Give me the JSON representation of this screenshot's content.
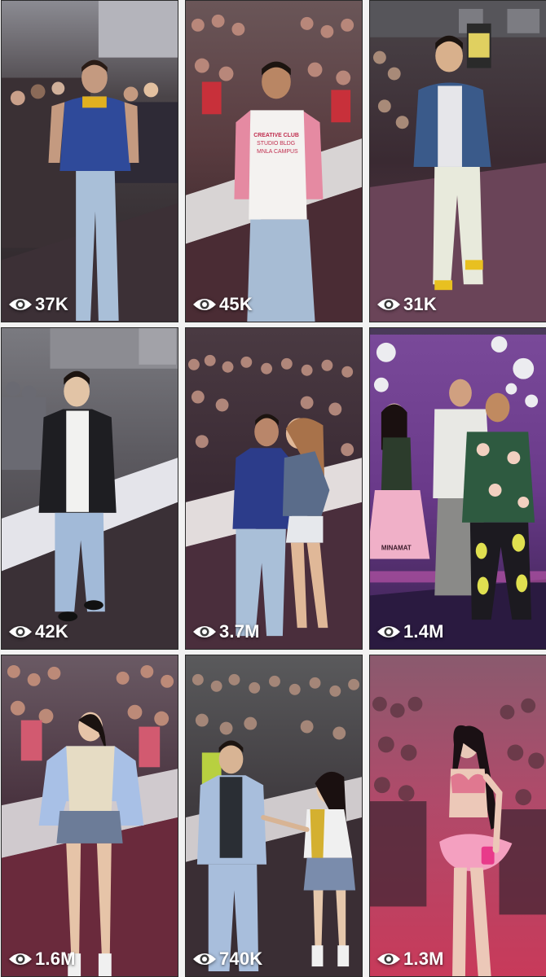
{
  "colors": {
    "text": "#ffffff",
    "border": "#2b2b2b",
    "page_bg": "#f2f2f2"
  },
  "tiles": [
    {
      "views": "37K",
      "icon": "eye-icon"
    },
    {
      "views": "45K",
      "icon": "eye-icon",
      "shirt_print": [
        "CREATIVE CLUB",
        "STUDIO BLDG",
        "MNLA CAMPUS"
      ]
    },
    {
      "views": "31K",
      "icon": "eye-icon"
    },
    {
      "views": "42K",
      "icon": "eye-icon"
    },
    {
      "views": "3.7M",
      "icon": "eye-icon"
    },
    {
      "views": "1.4M",
      "icon": "eye-icon",
      "skirt_print": "MINAMAT"
    },
    {
      "views": "1.6M",
      "icon": "eye-icon"
    },
    {
      "views": "740K",
      "icon": "eye-icon"
    },
    {
      "views": "1.3M",
      "icon": "eye-icon"
    }
  ]
}
